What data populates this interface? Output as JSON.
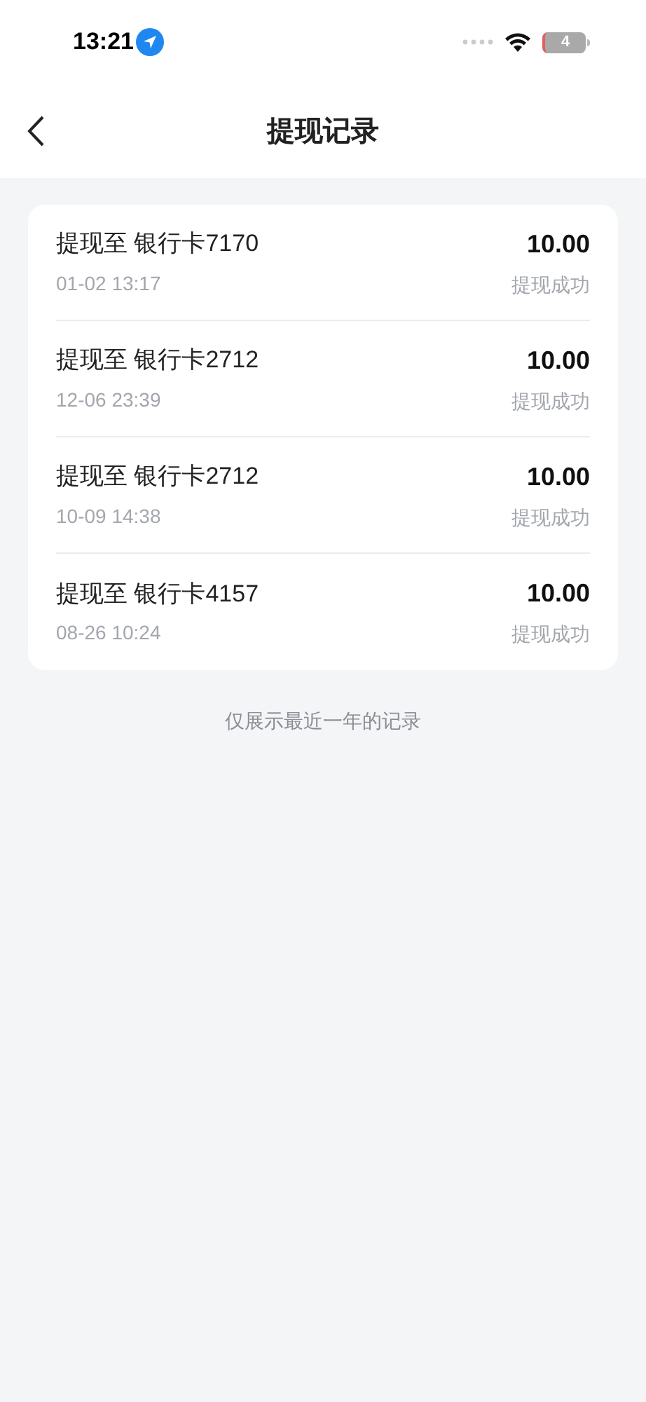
{
  "status_bar": {
    "time": "13:21",
    "battery": "4"
  },
  "header": {
    "title": "提现记录"
  },
  "records": [
    {
      "title": "提现至 银行卡7170",
      "time": "01-02 13:17",
      "amount": "10.00",
      "status": "提现成功"
    },
    {
      "title": "提现至 银行卡2712",
      "time": "12-06 23:39",
      "amount": "10.00",
      "status": "提现成功"
    },
    {
      "title": "提现至 银行卡2712",
      "time": "10-09 14:38",
      "amount": "10.00",
      "status": "提现成功"
    },
    {
      "title": "提现至 银行卡4157",
      "time": "08-26 10:24",
      "amount": "10.00",
      "status": "提现成功"
    }
  ],
  "footer_note": "仅展示最近一年的记录"
}
